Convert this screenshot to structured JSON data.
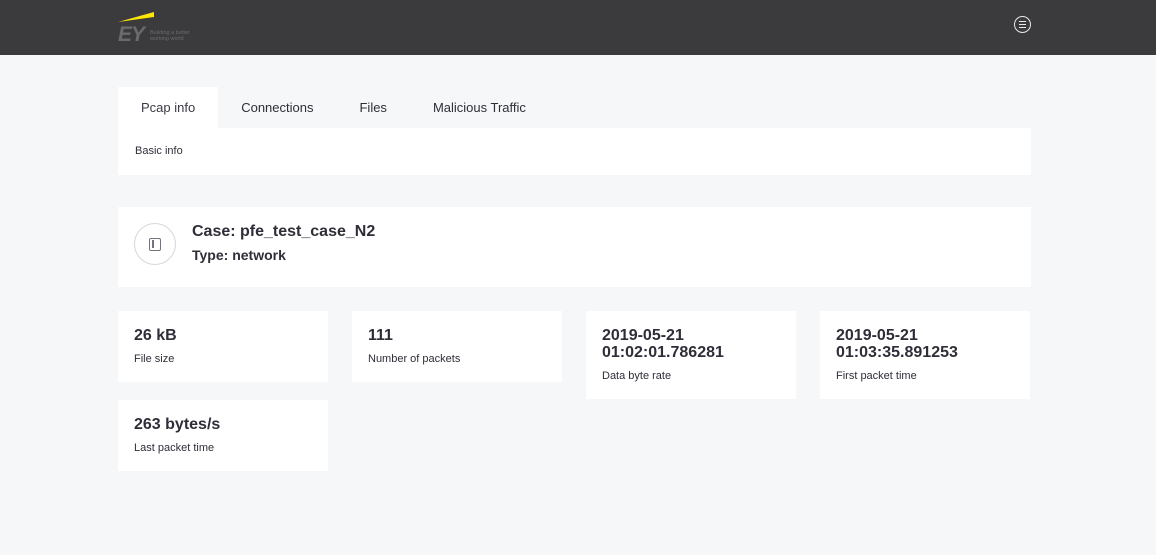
{
  "header": {
    "logo": {
      "mark": "EY",
      "tagline": "Building a better working world",
      "accent_color": "#ffe600"
    },
    "menu_icon": "menu-lines-icon"
  },
  "tabs": [
    {
      "label": "Pcap info",
      "active": true
    },
    {
      "label": "Connections",
      "active": false
    },
    {
      "label": "Files",
      "active": false
    },
    {
      "label": "Malicious Traffic",
      "active": false
    }
  ],
  "basic_info": {
    "label": "Basic info"
  },
  "case": {
    "icon": "device-icon",
    "title": "Case: pfe_test_case_N2",
    "type": "Type: network"
  },
  "stats": [
    {
      "value": "26 kB",
      "caption": "File size"
    },
    {
      "value": "111",
      "caption": "Number of packets"
    },
    {
      "value": "2019-05-21 01:02:01.786281",
      "caption": "Data byte rate"
    },
    {
      "value": "2019-05-21 01:03:35.891253",
      "caption": "First packet time"
    },
    {
      "value": "263 bytes/s",
      "caption": "Last packet time"
    }
  ]
}
